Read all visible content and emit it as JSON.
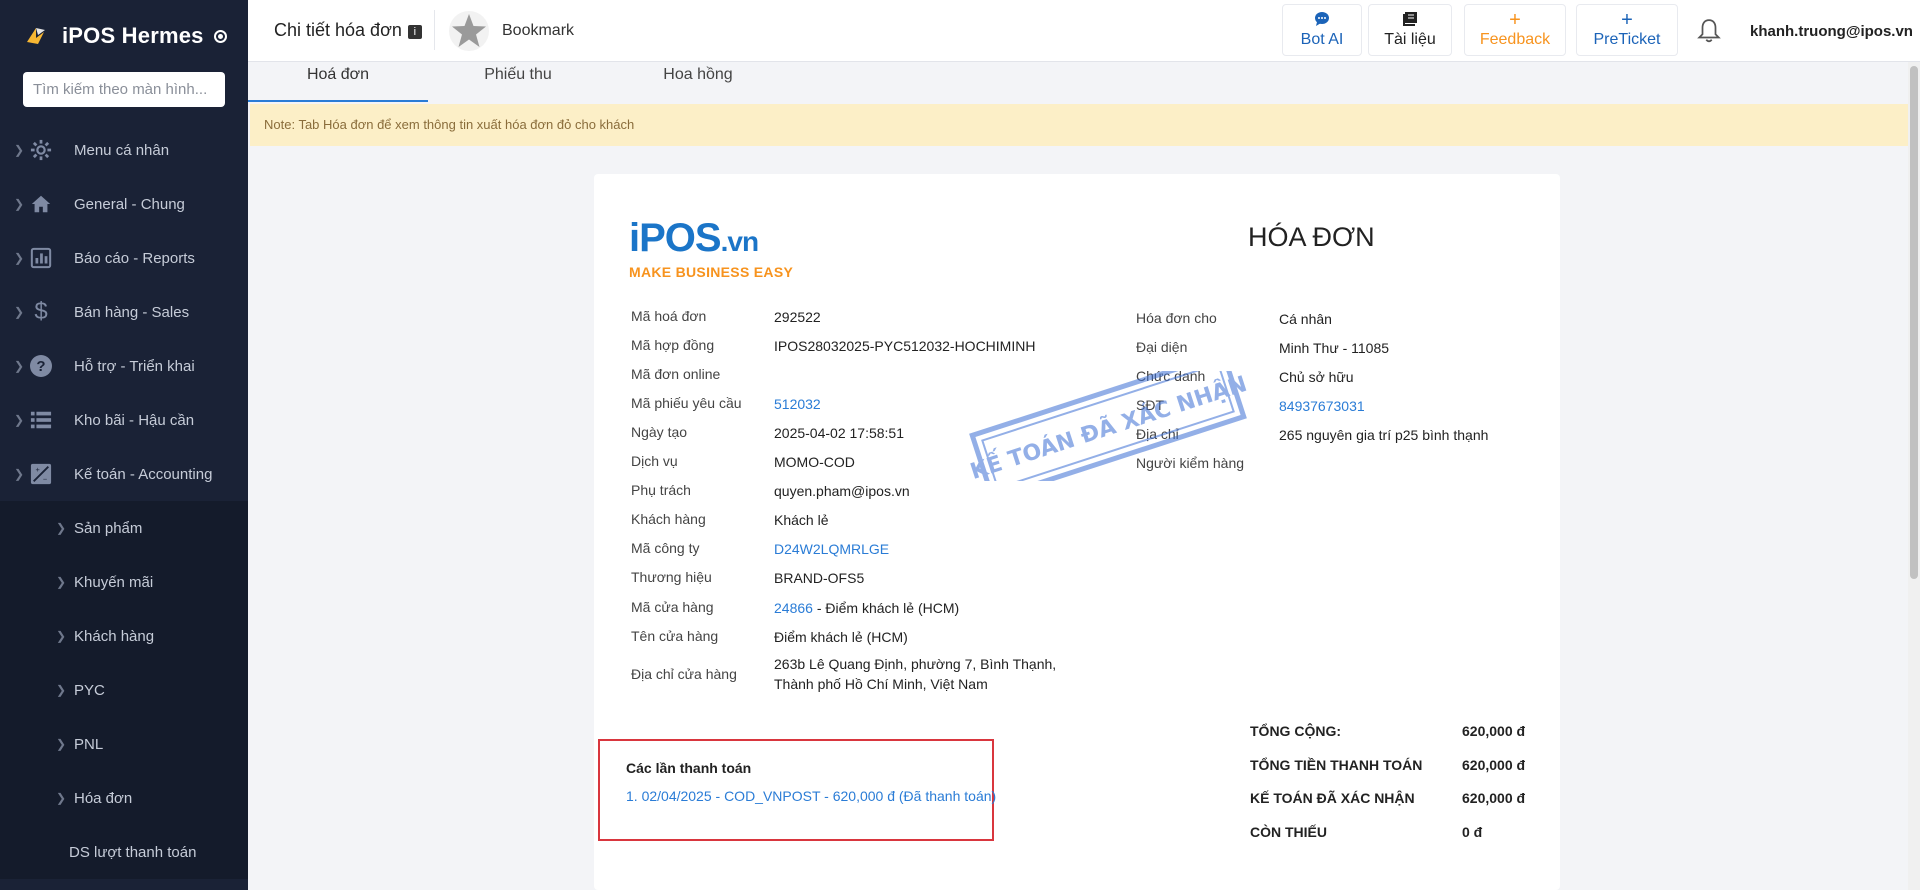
{
  "app": {
    "name": "iPOS Hermes"
  },
  "sidebar": {
    "search_placeholder": "Tìm kiếm theo màn hình...",
    "items": [
      {
        "label": "Menu cá nhân",
        "icon": "gear-icon"
      },
      {
        "label": "General - Chung",
        "icon": "home-icon"
      },
      {
        "label": "Báo cáo - Reports",
        "icon": "report-icon"
      },
      {
        "label": "Bán hàng - Sales",
        "icon": "dollar-icon"
      },
      {
        "label": "Hỗ trợ - Triển khai",
        "icon": "help-icon"
      },
      {
        "label": "Kho bãi - Hậu cần",
        "icon": "list-icon"
      },
      {
        "label": "Kế toán - Accounting",
        "icon": "accounting-icon"
      }
    ],
    "subitems": [
      {
        "label": "Sản phẩm"
      },
      {
        "label": "Khuyến mãi"
      },
      {
        "label": "Khách hàng"
      },
      {
        "label": "PYC"
      },
      {
        "label": "PNL"
      },
      {
        "label": "Hóa đơn"
      },
      {
        "label": "DS lượt thanh toán"
      }
    ]
  },
  "header": {
    "title": "Chi tiết hóa đơn",
    "bookmark": "Bookmark",
    "buttons": {
      "bot_ai": "Bot AI",
      "docs": "Tài liệu",
      "feedback": "Feedback",
      "preticket": "PreTicket"
    },
    "user_email": "khanh.truong@ipos.vn"
  },
  "colors": {
    "accent": "#2a7cd6",
    "feedback": "#f7931e",
    "sidebar": "#1a2236"
  },
  "tabs": [
    {
      "label": "Hoá đơn"
    },
    {
      "label": "Phiếu thu"
    },
    {
      "label": "Hoa hồng"
    }
  ],
  "note": "Note: Tab Hóa đơn để xem thông tin xuất hóa đơn đỏ cho khách",
  "invoice": {
    "logo_text": "iPOS",
    "logo_suffix": ".vn",
    "logo_tagline": "MAKE BUSINESS EASY",
    "title": "HÓA ĐƠN",
    "stamp_text": "KẾ TOÁN ĐÃ XÁC NHẬN",
    "left_fields": [
      {
        "label": "Mã hoá đơn",
        "value": "292522"
      },
      {
        "label": "Mã hợp đồng",
        "value": "IPOS28032025-PYC512032-HOCHIMINH"
      },
      {
        "label": "Mã đơn online",
        "value": ""
      },
      {
        "label": "Mã phiếu yêu cầu",
        "value": "512032"
      },
      {
        "label": "Ngày tạo",
        "value": "2025-04-02 17:58:51"
      },
      {
        "label": "Dịch vụ",
        "value": "MOMO-COD"
      },
      {
        "label": "Phụ trách",
        "value": "quyen.pham@ipos.vn"
      },
      {
        "label": "Khách hàng",
        "value": "Khách lẻ"
      },
      {
        "label": "Mã công ty",
        "value": "D24W2LQMRLGE"
      },
      {
        "label": "Thương hiệu",
        "value": "BRAND-OFS5"
      },
      {
        "label": "Mã cửa hàng",
        "value": "24866",
        "suffix": " - Điểm khách lẻ (HCM)"
      },
      {
        "label": "Tên cửa hàng",
        "value": "Điểm khách lẻ (HCM)"
      },
      {
        "label": "Địa chỉ cửa hàng",
        "value": "263b Lê Quang Định, phường 7, Bình Thạnh,",
        "value2": "Thành phố Hồ Chí Minh, Việt Nam"
      }
    ],
    "right_fields": [
      {
        "label": "Hóa đơn cho",
        "value": "Cá nhân"
      },
      {
        "label": "Đại diện",
        "value": "Minh Thư - 11085"
      },
      {
        "label": "Chức danh",
        "value": "Chủ sở hữu"
      },
      {
        "label": "SĐT",
        "value": "84937673031"
      },
      {
        "label": "Địa chỉ",
        "value": "265 nguyên gia trí p25 bình thạnh"
      },
      {
        "label": "Người kiểm hàng",
        "value": ""
      }
    ],
    "payments": {
      "title": "Các lần thanh toán",
      "items": [
        "1. 02/04/2025 - COD_VNPOST - 620,000 đ (Đã thanh toán)"
      ]
    },
    "totals": [
      {
        "label": "TỔNG CỘNG:",
        "value": "620,000 đ"
      },
      {
        "label": "TỔNG TIỀN THANH TOÁN",
        "value": "620,000 đ"
      },
      {
        "label": "KẾ TOÁN ĐÃ XÁC NHẬN",
        "value": "620,000 đ"
      },
      {
        "label": "CÒN THIẾU",
        "value": "0 đ"
      }
    ]
  }
}
